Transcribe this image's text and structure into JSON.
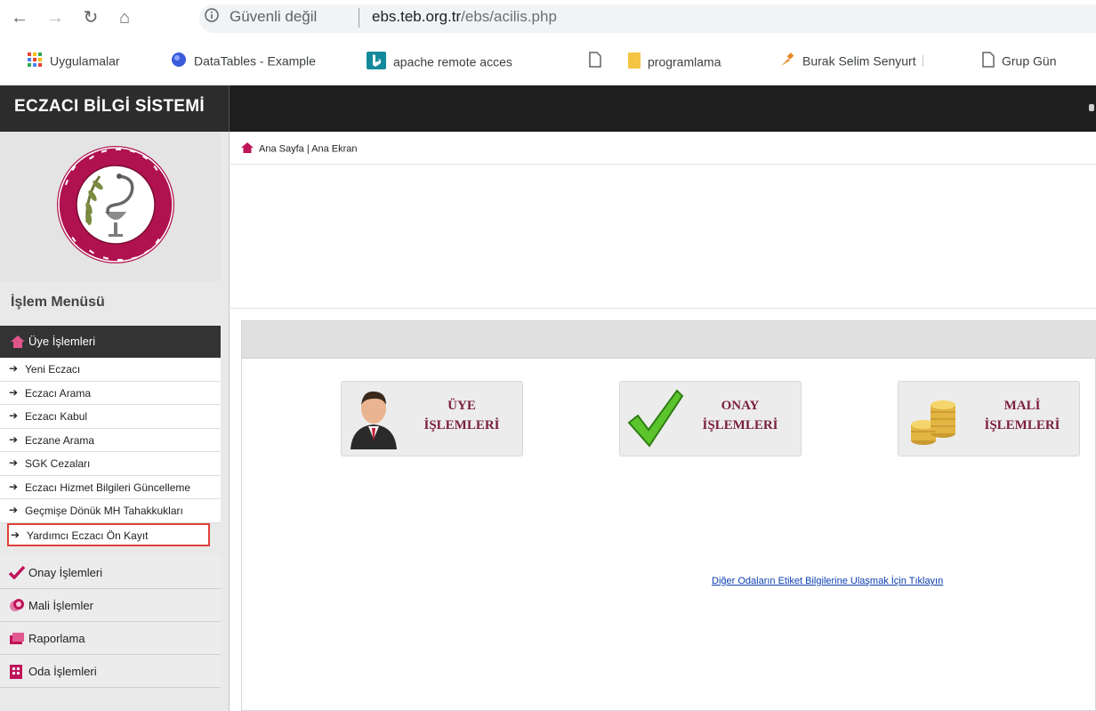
{
  "browser": {
    "security_label": "Güvenli değil",
    "url_host": "ebs.teb.org.tr",
    "url_path": "/ebs/acilis.php",
    "bookmarks": [
      {
        "label": "Uygulamalar",
        "icon": "apps-grid-icon"
      },
      {
        "label": "DataTables - Example",
        "icon": "globe-icon"
      },
      {
        "label": "apache remote acces",
        "icon": "bing-icon"
      },
      {
        "label": "",
        "icon": "page-icon"
      },
      {
        "label": "programlama",
        "icon": "folder-icon"
      },
      {
        "label": "Burak Selim Senyurt",
        "icon": "pin-icon"
      },
      {
        "label": "Grup Gün",
        "icon": "page-icon"
      }
    ]
  },
  "app": {
    "brand": "ECZACI BİLGİ SİSTEMİ"
  },
  "sidebar": {
    "menu_title": "İşlem Menüsü",
    "active_section": "Üye İşlemleri",
    "sub_items": [
      "Yeni Eczacı",
      "Eczacı Arama",
      "Eczacı Kabul",
      "Eczane Arama",
      "SGK Cezaları",
      "Eczacı Hizmet Bilgileri Güncelleme",
      "Geçmişe Dönük MH Tahakkukları",
      "Yardımcı Eczacı Ön Kayıt"
    ],
    "sections": [
      {
        "label": "Onay İşlemleri",
        "icon": "check-icon"
      },
      {
        "label": "Mali İşlemler",
        "icon": "coins-icon"
      },
      {
        "label": "Raporlama",
        "icon": "report-icon"
      },
      {
        "label": "Oda İşlemleri",
        "icon": "building-icon"
      }
    ]
  },
  "breadcrumb": "Ana Sayfa | Ana Ekran",
  "tiles": [
    {
      "line1": "ÜYE",
      "line2": "İŞLEMLERİ",
      "icon": "user-icon"
    },
    {
      "line1": "ONAY",
      "line2": "İŞLEMLERİ",
      "icon": "checkmark-icon"
    },
    {
      "line1": "MALİ",
      "line2": "İŞLEMLERİ",
      "icon": "coins-icon"
    }
  ],
  "link_text": "Diğer Odaların Etiket Bilgilerine Ulaşmak İçin Tıklayın",
  "colors": {
    "accent": "#c0145a",
    "header_bg": "#1e1e1e",
    "tile_text": "#7a1f3d",
    "highlight_border": "#e0403a"
  }
}
